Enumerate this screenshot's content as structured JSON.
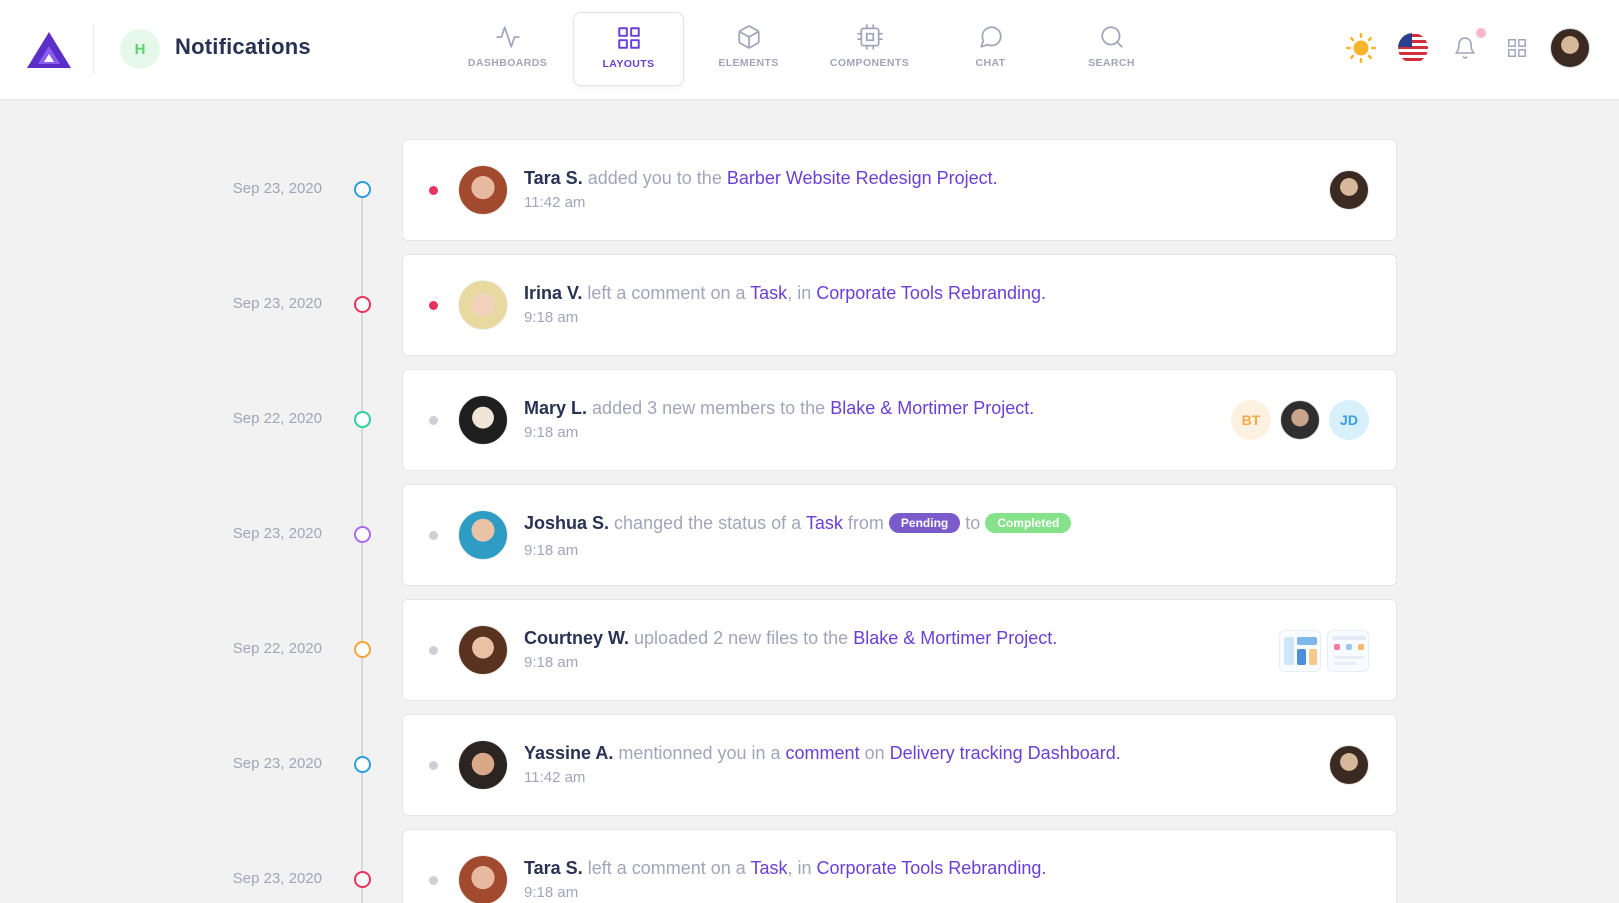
{
  "header": {
    "workspace_initial": "H",
    "page_title": "Notifications",
    "nav": [
      {
        "label": "DASHBOARDS",
        "icon": "activity-icon",
        "active": false
      },
      {
        "label": "LAYOUTS",
        "icon": "grid-icon",
        "active": true
      },
      {
        "label": "ELEMENTS",
        "icon": "box-icon",
        "active": false
      },
      {
        "label": "COMPONENTS",
        "icon": "cpu-icon",
        "active": false
      },
      {
        "label": "CHAT",
        "icon": "message-circle-icon",
        "active": false
      },
      {
        "label": "SEARCH",
        "icon": "search-icon",
        "active": false
      }
    ],
    "right_icons": [
      "sun-icon",
      "us-flag-icon",
      "bell-icon",
      "apps-grid-icon",
      "user-avatar"
    ]
  },
  "colors": {
    "accent": "#6a3fd6",
    "unread": "#e8325d",
    "timeline": [
      "#2c9fdb",
      "#e8325d",
      "#2fd0a0",
      "#a86cf0",
      "#f5a33b",
      "#2c9fdb",
      "#e8325d"
    ]
  },
  "notifications": [
    {
      "date": "Sep 23, 2020",
      "unread": true,
      "name": "Tara S.",
      "action": "added you to the",
      "link1": "Barber Website Redesign Project",
      "end": ".",
      "time": "11:42 am"
    },
    {
      "date": "Sep 23, 2020",
      "unread": true,
      "name": "Irina V.",
      "action": "left a comment on a",
      "link1": "Task",
      "mid": ", in",
      "link2": "Corporate Tools Rebranding",
      "end": ".",
      "time": "9:18 am"
    },
    {
      "date": "Sep 22, 2020",
      "unread": false,
      "name": "Mary L.",
      "action": "added 3 new members to the",
      "link1": "Blake & Mortimer Project",
      "end": ".",
      "time": "9:18 am",
      "members": [
        "BT",
        "JD"
      ]
    },
    {
      "date": "Sep 23, 2020",
      "unread": false,
      "name": "Joshua S.",
      "action": "changed the status of a",
      "link1": "Task",
      "mid": "from",
      "tag1": "Pending",
      "mid2": "to",
      "tag2": "Completed",
      "time": "9:18 am"
    },
    {
      "date": "Sep 22, 2020",
      "unread": false,
      "name": "Courtney W.",
      "action": "uploaded 2 new files to the",
      "link1": "Blake & Mortimer Project",
      "end": ".",
      "time": "9:18 am"
    },
    {
      "date": "Sep 23, 2020",
      "unread": false,
      "name": "Yassine A.",
      "action": "mentionned you in a",
      "link1": "comment",
      "mid": "on",
      "link2": "Delivery tracking Dashboard",
      "end": ".",
      "time": "11:42 am"
    },
    {
      "date": "Sep 23, 2020",
      "unread": false,
      "name": "Tara S.",
      "action": "left a comment on a",
      "link1": "Task",
      "mid": ", in",
      "link2": "Corporate Tools Rebranding",
      "end": ".",
      "time": "9:18 am"
    }
  ]
}
